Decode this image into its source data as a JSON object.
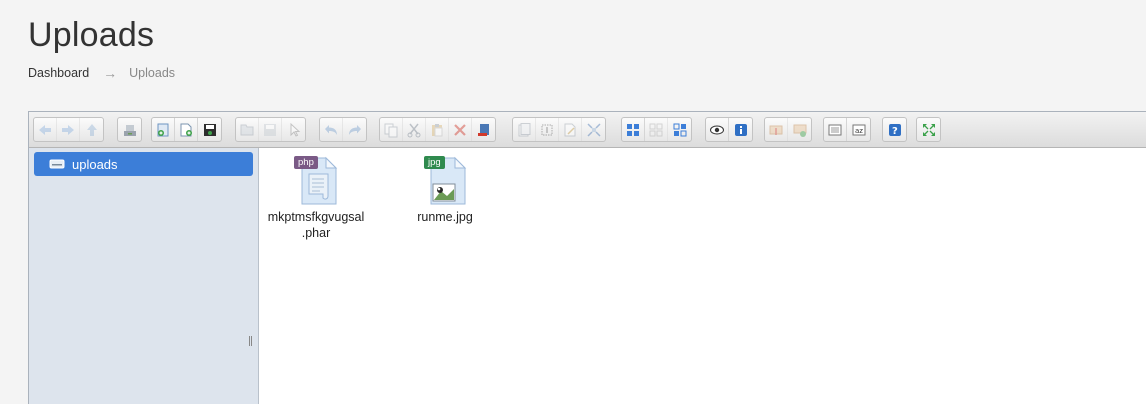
{
  "page": {
    "title": "Uploads",
    "breadcrumb": {
      "home": "Dashboard",
      "separator": "→",
      "current": "Uploads"
    }
  },
  "toolbar": {
    "groups": [
      [
        "back-icon",
        "forward-icon",
        "up-icon"
      ],
      [
        "home-icon"
      ],
      [
        "upload-icon",
        "new-file-icon",
        "save-icon"
      ],
      [
        "open-icon",
        "download-icon",
        "select-icon"
      ],
      [
        "undo-icon",
        "redo-icon"
      ],
      [
        "copy-icon",
        "cut-icon",
        "paste-icon",
        "delete-icon",
        "empty-icon"
      ],
      [
        "duplicate-icon",
        "rename-icon",
        "edit-icon",
        "resize-icon"
      ],
      [
        "select-all-icon",
        "select-none-icon",
        "invert-selection-icon"
      ],
      [
        "preview-icon",
        "info-icon"
      ],
      [
        "extract-icon",
        "archive-icon"
      ],
      [
        "list-view-icon",
        "sort-icon"
      ],
      [
        "help-icon"
      ],
      [
        "fullscreen-icon"
      ]
    ]
  },
  "sidebar": {
    "tree": [
      {
        "label": "uploads",
        "icon": "drive-icon",
        "selected": true
      }
    ]
  },
  "files": [
    {
      "name": "mkptmsfkgvugsal.phar",
      "line1": "mkptmsfkgvugsal",
      "line2": ".phar",
      "badge": "php",
      "badge_color": "#7a5a86"
    },
    {
      "name": "runme.jpg",
      "line1": "runme.jpg",
      "line2": "",
      "badge": "jpg",
      "badge_color": "#2f8a4e"
    }
  ],
  "colors": {
    "selection": "#3c7ed8",
    "sidebar_bg": "#dde4ed"
  }
}
